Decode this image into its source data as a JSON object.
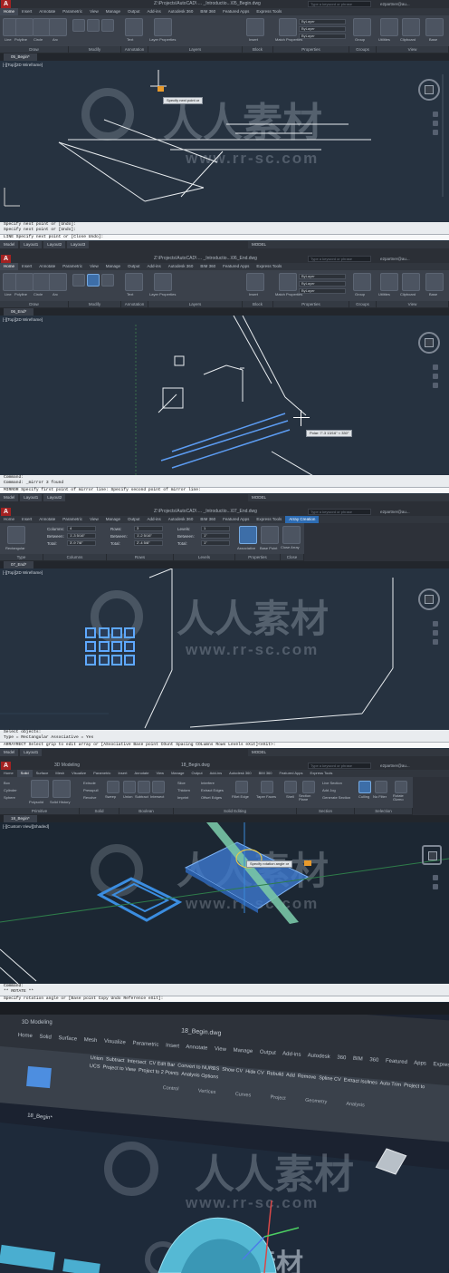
{
  "panel1": {
    "title": "Z:\\Projects\\AutoCAD\\ ... _Introductio...\\05_Begin.dwg",
    "search_placeholder": "Type a keyword or phrase",
    "user": "e2partner@au...",
    "tabs": [
      "Home",
      "Insert",
      "Annotate",
      "Parametric",
      "View",
      "Manage",
      "Output",
      "Add-ins",
      "Autodesk 360",
      "BIM 360",
      "Featured Apps",
      "Express Tools"
    ],
    "active_tab": "Home",
    "tools": [
      "Line",
      "Polyline",
      "Circle",
      "Arc",
      "Text",
      "Layer Properties",
      "Insert",
      "Match Properties",
      "Group",
      "Utilities",
      "Clipboard",
      "Base"
    ],
    "groups": [
      "Draw",
      "Modify",
      "Annotation",
      "Layers",
      "Block",
      "Properties",
      "Groups",
      "View"
    ],
    "layer_value": "ByLayer",
    "doc_tab": "05_Begin*",
    "viewport_label": "[-][Top][2D Wireframe]",
    "tooltip": "Specify next point or",
    "cmd_history": [
      "Specify next point or [Undo]:",
      "Specify next point or [Undo]:"
    ],
    "cmd_line": "LINE Specify next point or [Close Undo]:",
    "status_tabs": [
      "Model",
      "Layout1",
      "Layout2",
      "Layout3"
    ],
    "status_model": "MODEL"
  },
  "panel2": {
    "title": "Z:\\Projects\\AutoCAD\\ ... _Introductio...\\06_End.dwg",
    "doc_tab": "06_End*",
    "viewport_label": "[-][Top][2D Wireframe]",
    "tooltip": "Polar: 7'-3 13/16\" < 330°",
    "cmd_history": [
      "Command:",
      "Command: _mirror 3 found"
    ],
    "cmd_line": "MIRROR Specify first point of mirror line: Specify second point of mirror line:"
  },
  "panel3": {
    "title": "Z:\\Projects\\AutoCAD\\ ... _Introductio...\\07_End.dwg",
    "contextual_tab": "Array Creation",
    "type_label": "Rectangular",
    "columns": {
      "label": "Columns:",
      "between_label": "Between:",
      "total_label": "Total:",
      "count": "4",
      "between": "1'-3 5/16\"",
      "total": "3'-9 7/8\""
    },
    "rows": {
      "label": "Rows:",
      "between_label": "Between:",
      "total_label": "Total:",
      "count": "3",
      "between": "1'-2 5/16\"",
      "total": "2'-4 5/8\""
    },
    "levels": {
      "label": "Levels:",
      "between_label": "Between:",
      "total_label": "Total:",
      "count": "1",
      "between": "1\"",
      "total": "1\""
    },
    "props": [
      "Associative",
      "Base Point"
    ],
    "close_label": "Close Array",
    "groups": [
      "Type",
      "Columns",
      "Rows",
      "Levels",
      "Properties",
      "Close"
    ],
    "doc_tab": "07_End*",
    "viewport_label": "[-][Top][2D Wireframe]",
    "cmd_history": [
      "Select objects:",
      "Type = Rectangular  Associative = Yes"
    ],
    "cmd_line": "ARRAYRECT Select grip to edit array or [ASsociative Base point COunt Spacing COLumns Rows Levels eXit]<eXit>:"
  },
  "panel4": {
    "workspace": "3D Modeling",
    "title": "18_Begin.dwg",
    "tabs": [
      "Home",
      "Solid",
      "Surface",
      "Mesh",
      "Visualize",
      "Parametric",
      "Insert",
      "Annotate",
      "View",
      "Manage",
      "Output",
      "Add-ins",
      "Autodesk 360",
      "BIM 360",
      "Featured Apps",
      "Express Tools"
    ],
    "active_tab": "Solid",
    "tools": [
      "Box",
      "Cylinder",
      "Sphere",
      "Polysolid",
      "Solid History",
      "Extrude",
      "Presspull",
      "Sweep",
      "Revolve",
      "Union",
      "Subtract",
      "Intersect",
      "Slice",
      "Thicken",
      "Imprint",
      "Interfere",
      "Extract Edges",
      "Offset Edges",
      "Fillet Edge",
      "Taper Faces",
      "Shell",
      "Section Plane",
      "Live Section",
      "Add Jog",
      "Generate Section",
      "Culling",
      "No Filter",
      "Rotate Gizmo"
    ],
    "groups": [
      "Primitive",
      "Solid",
      "Boolean",
      "Solid Editing",
      "Section",
      "Selection"
    ],
    "doc_tab": "18_Begin*",
    "viewport_label": "[-][Custom View][Shaded]",
    "tooltip": "Specify rotation angle or",
    "cmd_history": [
      "Command:",
      "** ROTATE **"
    ],
    "cmd_line": "Specify rotation angle or [Base point Copy Undo Reference eXit]:"
  },
  "panel5": {
    "workspace": "3D Modeling",
    "title": "18_Begin.dwg",
    "tabs": [
      "Home",
      "Solid",
      "Surface",
      "Mesh",
      "Visualize",
      "Parametric",
      "Insert",
      "Annotate",
      "View",
      "Manage",
      "Output",
      "Add-ins",
      "Autodesk 360",
      "BIM 360",
      "Featured Apps",
      "Express Tools"
    ],
    "tools": [
      "Union",
      "Subtract",
      "Intersect",
      "CV Edit Bar",
      "Convert to NURBS",
      "Show CV",
      "Hide CV",
      "Rebuild",
      "Add",
      "Remove",
      "Spline CV",
      "Extract Isolines",
      "Auto Trim",
      "Project to UCS",
      "Project to View",
      "Project to 2 Points",
      "Analysis Options"
    ],
    "groups": [
      "Control Vertices",
      "Curves",
      "Project Geometry",
      "Analysis"
    ],
    "doc_tab": "18_Begin*"
  },
  "watermark": {
    "brand": "人人素材",
    "url": "www.rr-sc.com"
  },
  "colors": {
    "viewport_bg": "#263240",
    "ribbon": "#3b414b",
    "accent_blue": "#4d8ee0",
    "logo_red": "#a32222",
    "selection_blue": "#5ea8ff"
  }
}
